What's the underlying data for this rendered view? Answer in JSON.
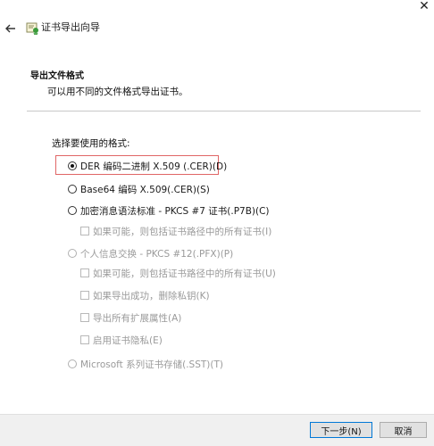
{
  "window": {
    "title": "证书导出向导",
    "close_glyph": "✕",
    "back_glyph": "←"
  },
  "page": {
    "heading": "导出文件格式",
    "subheading": "可以用不同的文件格式导出证书。",
    "prompt": "选择要使用的格式:"
  },
  "options": [
    {
      "label": "DER 编码二进制 X.509 (.CER)(D)",
      "checked": true,
      "enabled": true
    },
    {
      "label": "Base64 编码 X.509(.CER)(S)",
      "checked": false,
      "enabled": true
    },
    {
      "label": "加密消息语法标准 - PKCS #7 证书(.P7B)(C)",
      "checked": false,
      "enabled": true
    },
    {
      "label": "个人信息交换 - PKCS #12(.PFX)(P)",
      "checked": false,
      "enabled": false
    },
    {
      "label": "Microsoft 系列证书存储(.SST)(T)",
      "checked": false,
      "enabled": false
    }
  ],
  "checkboxes": {
    "p7b_include_path": "如果可能，则包括证书路径中的所有证书(I)",
    "pfx_include_path": "如果可能，则包括证书路径中的所有证书(U)",
    "pfx_delete_key": "如果导出成功，删除私钥(K)",
    "pfx_export_ext": "导出所有扩展属性(A)",
    "pfx_enable_privacy": "启用证书隐私(E)"
  },
  "buttons": {
    "next": "下一步(N)",
    "cancel": "取消"
  },
  "colors": {
    "highlight": "#e06666",
    "disabled_text": "#9a9a9a",
    "primary_border": "#0078d7"
  }
}
